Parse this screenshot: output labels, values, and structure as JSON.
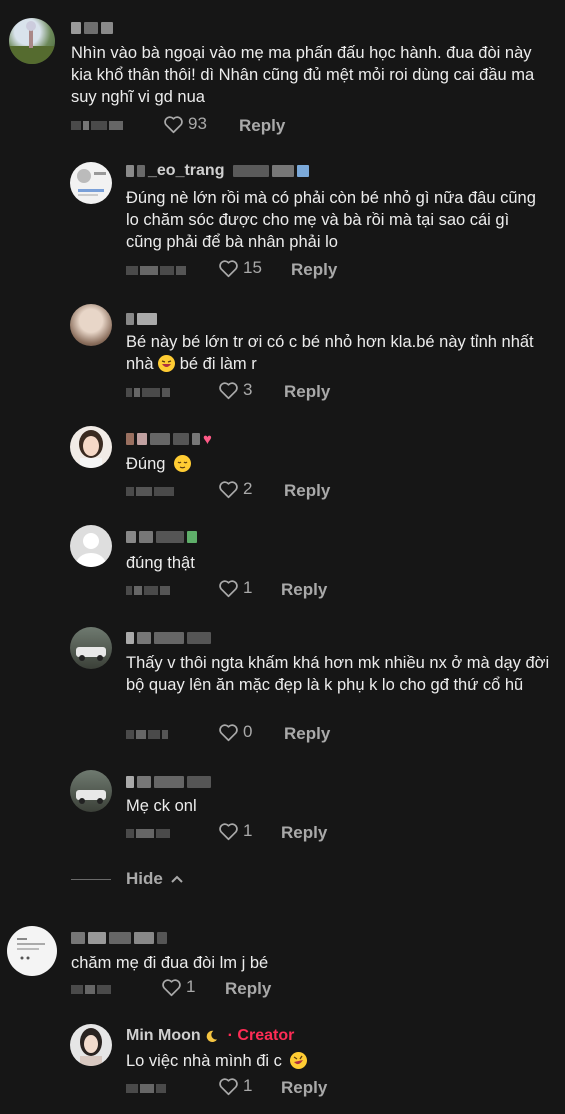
{
  "comments": [
    {
      "text": "Nhìn vào bà ngoại vào mẹ ma phấn đấu học hành. đua đòi này kia khổ thân thôi! dì Nhân cũng đủ mệt mỏi roi dùng cai đầu ma suy nghĩ vi gd nua",
      "likes": "93",
      "reply": "Reply"
    },
    {
      "username": "_eo_trang",
      "text": "Đúng nè lớn rồi mà có phải còn bé nhỏ gì nữa đâu cũng lo chăm sóc được cho mẹ và bà rồi mà tại sao cái gì cũng phải để bà nhân phải lo",
      "likes": "15",
      "reply": "Reply"
    },
    {
      "text": "Bé này bé lớn tr ơi có c bé nhỏ hơn kla.bé này tỉnh nhất nhà",
      "text_after": "bé đi làm r",
      "likes": "3",
      "reply": "Reply"
    },
    {
      "text": "Đúng",
      "likes": "2",
      "reply": "Reply"
    },
    {
      "text": "đúng thật",
      "likes": "1",
      "reply": "Reply"
    },
    {
      "text": "Thấy v thôi ngta khấm khá hơn mk nhiều nx ở mà dạy đời bộ quay lên ăn mặc đẹp là k phụ k lo cho gđ thứ cổ hũ",
      "likes": "0",
      "reply": "Reply"
    },
    {
      "text": "Mẹ ck onl",
      "likes": "1",
      "reply": "Reply"
    },
    {
      "text": "chăm mẹ đi đua đòi lm j bé",
      "likes": "1",
      "reply": "Reply"
    },
    {
      "username": "Min Moon",
      "creator": "· Creator",
      "text": "Lo việc nhà mình đi c",
      "likes": "1",
      "reply": "Reply"
    }
  ],
  "hide_label": "Hide",
  "icons": {
    "like": "heart-outline-icon",
    "collapse": "chevron-up-icon"
  },
  "colors": {
    "background": "#161616",
    "text": "#ececec",
    "muted": "#a9a9a9",
    "creator": "#fe2c55"
  }
}
